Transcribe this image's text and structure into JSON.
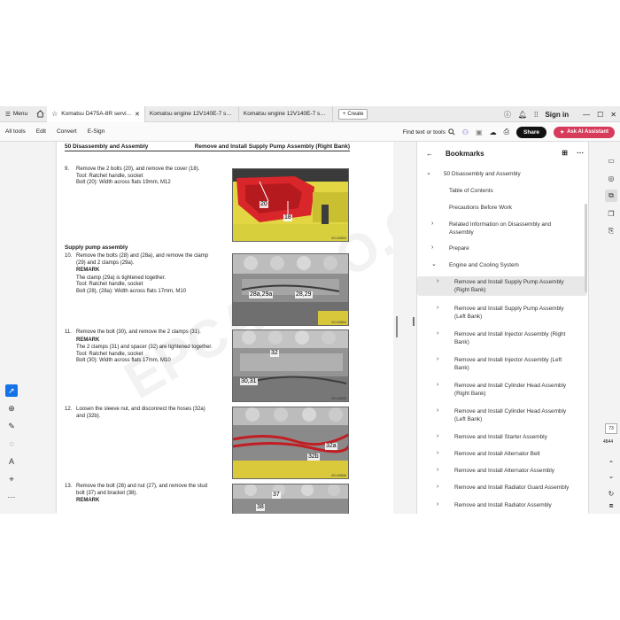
{
  "tabbar": {
    "menu_label": "Menu",
    "tabs": [
      {
        "title": "Komatsu D475A-8R servi...",
        "active": true
      },
      {
        "title": "Komatsu engine 12V140E-7 servi...",
        "active": false
      },
      {
        "title": "Komatsu engine 12V140E-7 servi...",
        "active": false
      }
    ],
    "create_label": "Create",
    "signin_label": "Sign in"
  },
  "toolbar": {
    "items": [
      "All tools",
      "Edit",
      "Convert",
      "E-Sign"
    ],
    "find_label": "Find text or tools",
    "share_label": "Share",
    "ai_label": "Ask AI Assistant"
  },
  "page": {
    "header_left": "50 Disassembly and Assembly",
    "header_right": "Remove and Install Supply Pump Assembly (Right Bank)",
    "watermark": "EPCATALO.COM",
    "section_heading": "Supply pump assembly",
    "steps": [
      {
        "num": "9.",
        "lines": [
          "Remove the 2 bolts (20), and remove the cover (18).",
          "Tool: Ratchet handle, socket",
          "Bolt (20): Width across flats 19mm, M12"
        ],
        "remark": null,
        "after": []
      },
      {
        "num": "10.",
        "lines": [
          "Remove the bolts (28) and (28a), and remove the clamp",
          "(29) and 2 clamps (29a)."
        ],
        "remark": "REMARK",
        "after": [
          "The clamp (29a) is tightened together.",
          "Tool: Ratchet handle, socket",
          "Bolt (28), (28a): Width across flats 17mm, M10"
        ]
      },
      {
        "num": "11.",
        "lines": [
          "Remove the bolt (30), and remove the 2 clamps (31)."
        ],
        "remark": "REMARK",
        "after": [
          "The 2 clamps (31) and spacer (32) are tightened together.",
          "Tool: Ratchet handle, socket",
          "Bolt (30): Width across flats 17mm, M10"
        ]
      },
      {
        "num": "12.",
        "lines": [
          "Loosen the sleeve nut, and disconnect the hoses (32a)",
          "and (32b)."
        ],
        "remark": null,
        "after": []
      },
      {
        "num": "13.",
        "lines": [
          "Remove the bolt (26) and nut (27), and remove the stud",
          "bolt (37) and bracket (38)."
        ],
        "remark": "REMARK",
        "after": []
      }
    ],
    "photos": [
      {
        "callouts": [
          "20",
          "18"
        ],
        "code": "001-50803"
      },
      {
        "callouts": [
          "28a,29a",
          "28,29"
        ],
        "code": "001-50804"
      },
      {
        "callouts": [
          "32",
          "30,31"
        ],
        "code": "001-50805"
      },
      {
        "callouts": [
          "32a",
          "32b"
        ],
        "code": "001-50806"
      },
      {
        "callouts": [
          "37",
          "38"
        ],
        "code": ""
      }
    ]
  },
  "bookmarks": {
    "title": "Bookmarks",
    "items": [
      {
        "label": "50 Disassembly and Assembly",
        "level": 0,
        "expander": "down"
      },
      {
        "label": "Table of Contents",
        "level": 1,
        "expander": ""
      },
      {
        "label": "Precautions Before Work",
        "level": 1,
        "expander": ""
      },
      {
        "label": "Related Information on Disassembly and Assembly",
        "level": 1,
        "expander": "right"
      },
      {
        "label": "Prepare",
        "level": 1,
        "expander": "right"
      },
      {
        "label": "Engine and Cooling System",
        "level": 1,
        "expander": "down"
      },
      {
        "label": "Remove and Install Supply Pump Assembly (Right Bank)",
        "level": 2,
        "expander": "right",
        "selected": true
      },
      {
        "label": "Remove and Install Supply Pump Assembly (Left Bank)",
        "level": 2,
        "expander": "right"
      },
      {
        "label": "Remove and Install Injector Assembly (Right Bank)",
        "level": 2,
        "expander": "right"
      },
      {
        "label": "Remove and Install Injector Assembly (Left Bank)",
        "level": 2,
        "expander": "right"
      },
      {
        "label": "Remove and Install Cylinder Head Assembly (Right Bank)",
        "level": 2,
        "expander": "right"
      },
      {
        "label": "Remove and Install Cylinder Head Assembly (Left Bank)",
        "level": 2,
        "expander": "right"
      },
      {
        "label": "Remove and Install Starter Assembly",
        "level": 2,
        "expander": "right"
      },
      {
        "label": "Remove and Install Alternator Belt",
        "level": 2,
        "expander": "right"
      },
      {
        "label": "Remove and Install Alternator Assembly",
        "level": 2,
        "expander": "right"
      },
      {
        "label": "Remove and Install Radiator Guard Assembly",
        "level": 2,
        "expander": "right"
      },
      {
        "label": "Remove and Install Radiator Assembly",
        "level": 2,
        "expander": "right"
      }
    ]
  },
  "right_rail": {
    "page_number": "73",
    "page_total": "4844"
  },
  "colors": {
    "accent": "#1473e6",
    "ai_button": "#d63b5a",
    "share_button": "#111111"
  }
}
